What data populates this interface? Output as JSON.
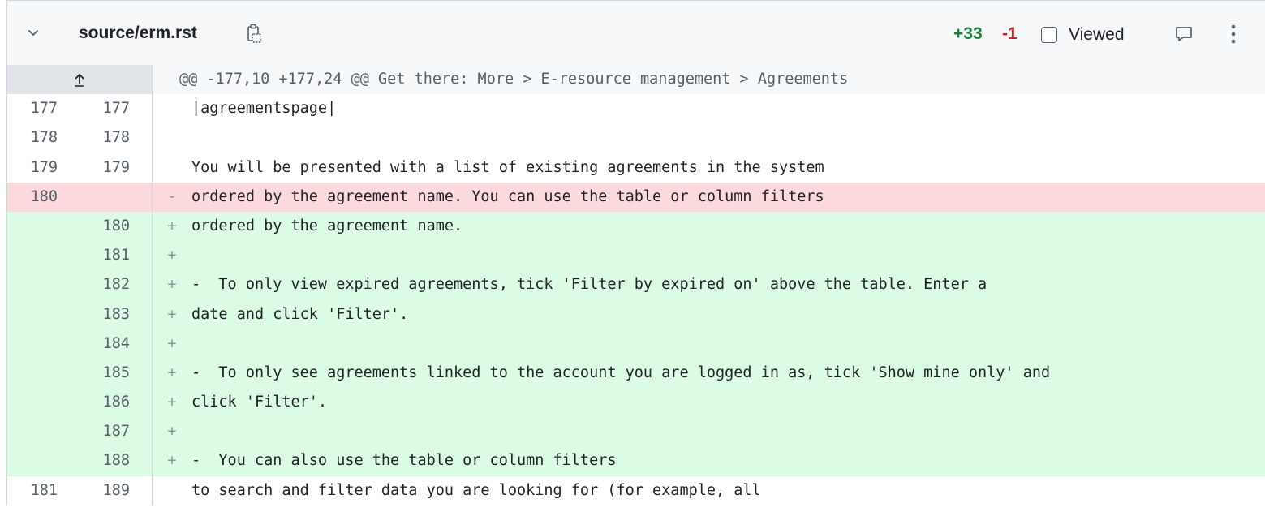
{
  "file": {
    "path": "source/erm.rst",
    "additions": "+33",
    "deletions": "-1",
    "viewed_label": "Viewed",
    "chevron_icon": "chevron-down-icon",
    "copy_icon": "copy-icon",
    "comment_icon": "comment-icon",
    "more_icon": "kebab-icon"
  },
  "hunk": {
    "header": "@@ -177,10 +177,24 @@ Get there: More > E-resource management > Agreements",
    "expand_icon": "expand-up-icon"
  },
  "lines": [
    {
      "type": "context",
      "old": "177",
      "new": "177",
      "marker": "",
      "code": "|agreementspage|"
    },
    {
      "type": "context",
      "old": "178",
      "new": "178",
      "marker": "",
      "code": ""
    },
    {
      "type": "context",
      "old": "179",
      "new": "179",
      "marker": "",
      "code": "You will be presented with a list of existing agreements in the system"
    },
    {
      "type": "del",
      "old": "180",
      "new": "",
      "marker": "-",
      "code": "ordered by the agreement name. You can use the table or column filters"
    },
    {
      "type": "add",
      "old": "",
      "new": "180",
      "marker": "+",
      "code": "ordered by the agreement name."
    },
    {
      "type": "add",
      "old": "",
      "new": "181",
      "marker": "+",
      "code": ""
    },
    {
      "type": "add",
      "old": "",
      "new": "182",
      "marker": "+",
      "code": "-  To only view expired agreements, tick 'Filter by expired on' above the table. Enter a"
    },
    {
      "type": "add",
      "old": "",
      "new": "183",
      "marker": "+",
      "code": "date and click 'Filter'."
    },
    {
      "type": "add",
      "old": "",
      "new": "184",
      "marker": "+",
      "code": ""
    },
    {
      "type": "add",
      "old": "",
      "new": "185",
      "marker": "+",
      "code": "-  To only see agreements linked to the account you are logged in as, tick 'Show mine only' and"
    },
    {
      "type": "add",
      "old": "",
      "new": "186",
      "marker": "+",
      "code": "click 'Filter'."
    },
    {
      "type": "add",
      "old": "",
      "new": "187",
      "marker": "+",
      "code": ""
    },
    {
      "type": "add",
      "old": "",
      "new": "188",
      "marker": "+",
      "code": "-  You can also use the table or column filters"
    },
    {
      "type": "context",
      "old": "181",
      "new": "189",
      "marker": "",
      "code": "to search and filter data you are looking for (for example, all"
    }
  ]
}
